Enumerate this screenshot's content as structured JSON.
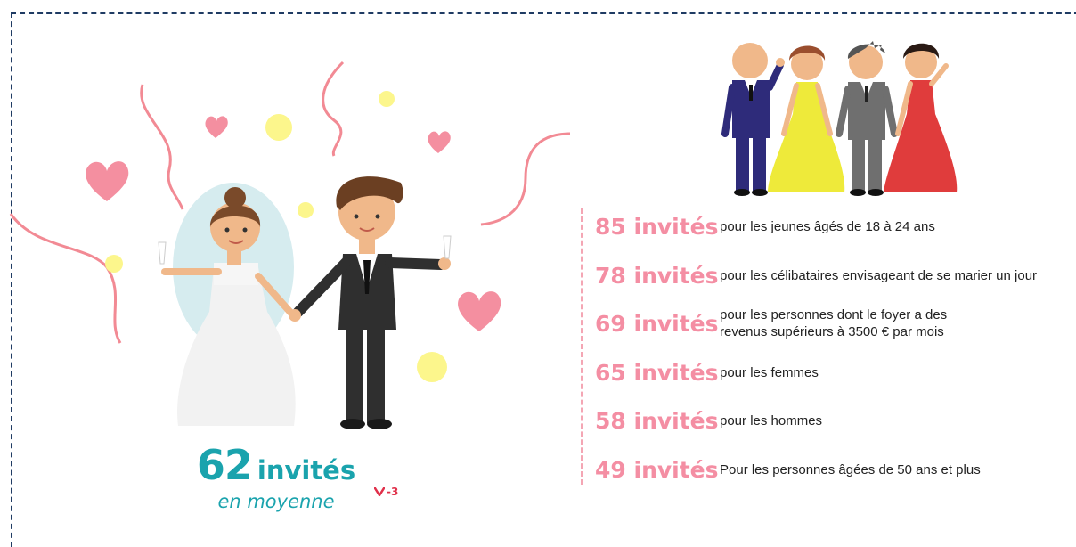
{
  "summary": {
    "number": "62",
    "unit": "invités",
    "subtitle": "en moyenne",
    "delta": "-3"
  },
  "stats": [
    {
      "value": "85 invités",
      "description": "pour les jeunes âgés de 18 à 24 ans"
    },
    {
      "value": "78 invités",
      "description": "pour les célibataires envisageant de se marier un jour"
    },
    {
      "value": "69 invités",
      "description": "pour les personnes dont le foyer a des revenus supérieurs à 3500 € par mois"
    },
    {
      "value": "65 invités",
      "description": "pour les femmes"
    },
    {
      "value": "58 invités",
      "description": "pour les hommes"
    },
    {
      "value": "49 invités",
      "description": "Pour les personnes âgées de 50 ans et plus"
    }
  ],
  "colors": {
    "accent": "#1aa3ad",
    "stat": "#f48ea3",
    "delta": "#e0304a",
    "frame": "#1f3b63"
  },
  "icons": {
    "delta": "down-chevron-icon",
    "illustration": "wedding-couple-illustration",
    "guests": "wedding-guests-illustration"
  }
}
